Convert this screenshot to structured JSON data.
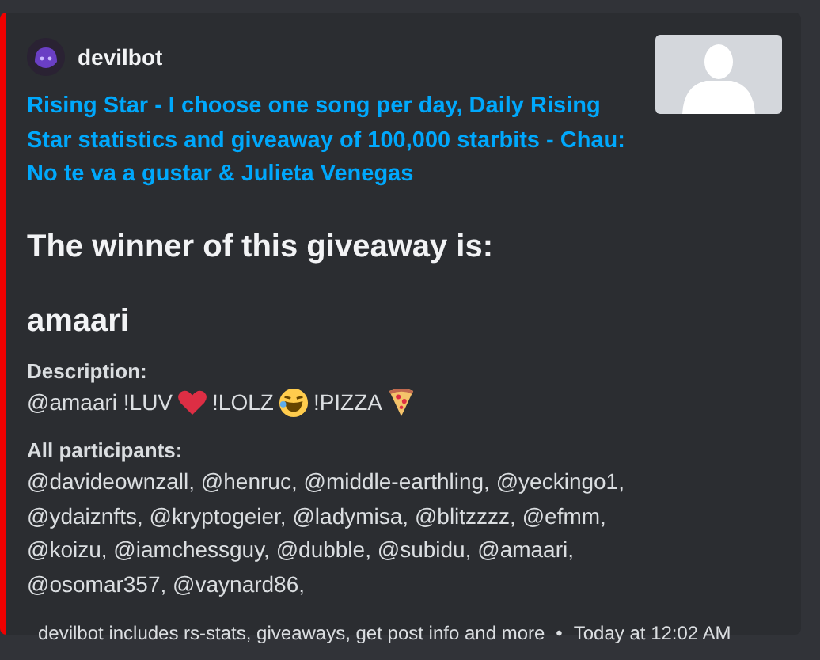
{
  "embed": {
    "author": "devilbot",
    "title": "Rising Star - I choose one song per day,  Daily Rising Star statistics and giveaway of 100,000 starbits -  Chau: No te va a gustar & Julieta Venegas",
    "heading": "The winner of this giveaway is:",
    "winner": "amaari",
    "fields": [
      {
        "name": "Description:",
        "segments": [
          "@amaari !LUV",
          "!LOLZ",
          "!PIZZA"
        ]
      },
      {
        "name": "All participants:",
        "segments": [
          "@davideownzall, @henruc, @middle-earthling, @yeckingo1, @ydaiznfts, @kryptogeier, @ladymisa, @blitzzzz, @efmm, @koizu, @iamchessguy, @dubble, @subidu, @amaari, @osomar357, @vaynard86,"
        ]
      }
    ],
    "footer": {
      "text": "devilbot includes rs-stats, giveaways, get post info and more",
      "separator": "•",
      "time": "Today at 12:02 AM"
    }
  }
}
